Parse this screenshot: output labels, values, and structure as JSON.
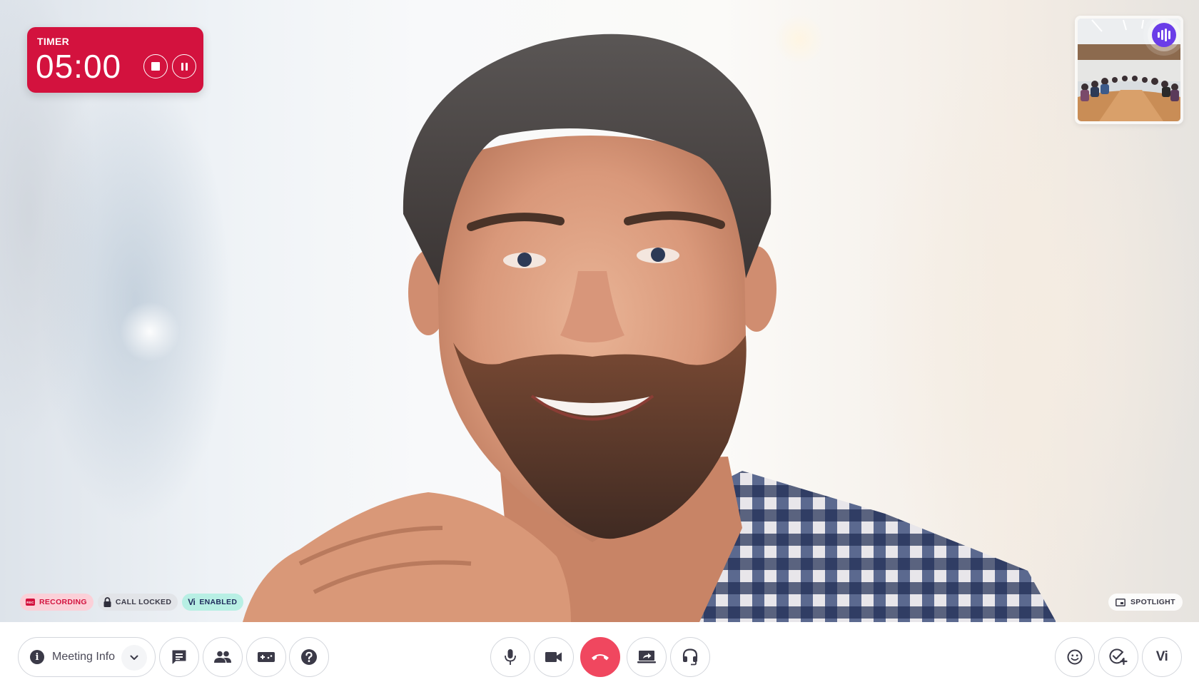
{
  "timer": {
    "label": "TIMER",
    "value": "05:00",
    "stop_button": "stop-icon",
    "pause_button": "pause-icon",
    "background_color": "#d3123e"
  },
  "thumbnail": {
    "description": "Conference room participants",
    "speaking_indicator": "audio-waves-icon",
    "indicator_color": "#6a3de8"
  },
  "badges": [
    {
      "id": "recording",
      "icon": "rec-icon",
      "icon_text": "REC",
      "label": "RECORDING"
    },
    {
      "id": "call-locked",
      "icon": "lock-icon",
      "label": "CALL LOCKED"
    },
    {
      "id": "vi-enabled",
      "icon": "vi-logo",
      "icon_text": "Vi",
      "label": "ENABLED"
    }
  ],
  "spotlight": {
    "icon": "spotlight-icon",
    "label": "SPOTLIGHT"
  },
  "toolbar": {
    "meeting_info_label": "Meeting Info",
    "left": [
      {
        "id": "chat",
        "icon": "chat-icon"
      },
      {
        "id": "participants",
        "icon": "participants-icon"
      },
      {
        "id": "games",
        "icon": "gamepad-icon"
      },
      {
        "id": "help",
        "icon": "help-icon"
      }
    ],
    "center": [
      {
        "id": "microphone",
        "icon": "microphone-icon"
      },
      {
        "id": "camera",
        "icon": "camera-icon"
      },
      {
        "id": "end-call",
        "icon": "phone-hangup-icon",
        "color": "#f0475f"
      },
      {
        "id": "share-screen",
        "icon": "share-screen-icon"
      },
      {
        "id": "audio-settings",
        "icon": "headset-icon"
      }
    ],
    "right": [
      {
        "id": "reactions",
        "icon": "emoji-icon"
      },
      {
        "id": "add-task",
        "icon": "task-add-icon"
      },
      {
        "id": "vi-assistant",
        "icon": "vi-logo",
        "text": "Vi"
      }
    ]
  }
}
